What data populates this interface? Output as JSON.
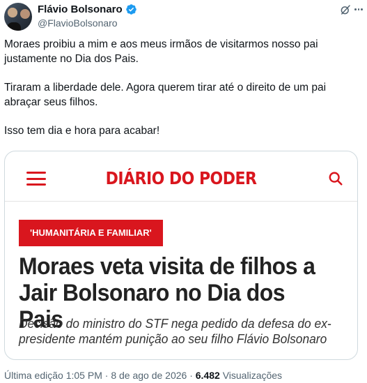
{
  "author": {
    "display_name": "Flávio Bolsonaro",
    "handle": "@FlavioBolsonaro",
    "verified": true,
    "verified_color": "#1d9bf0"
  },
  "tweet": {
    "paragraphs": [
      "Moraes proibiu a mim e aos meus irmãos de visitarmos nosso pai justamente no Dia dos Pais.",
      "Tiraram a liberdade dele. Agora querem tirar até o direito de um pai abraçar seus filhos.",
      "Isso tem dia e hora para acabar!"
    ]
  },
  "card": {
    "site_name": "DIÁRIO DO PODER",
    "brand_color": "#d9161e",
    "icons": {
      "menu": "hamburger-menu-icon",
      "search": "search-icon"
    },
    "tag": "'HUMANITÁRIA E FAMILIAR'",
    "headline": "Moraes veta visita de filhos a Jair Bolsonaro no Dia dos Pais",
    "subtitle": "Decisão do ministro do STF nega pedido da defesa do ex-presidente mantém punição ao seu filho Flávio Bolsonaro"
  },
  "meta": {
    "edited_prefix": "Última edição",
    "time": "1:05 PM",
    "separator": "·",
    "date": "8 de ago de 2026",
    "views_count": "6.482",
    "views_label": "Visualizações"
  },
  "header_icons": {
    "grok": "grok-icon",
    "more": "more-options-icon"
  }
}
